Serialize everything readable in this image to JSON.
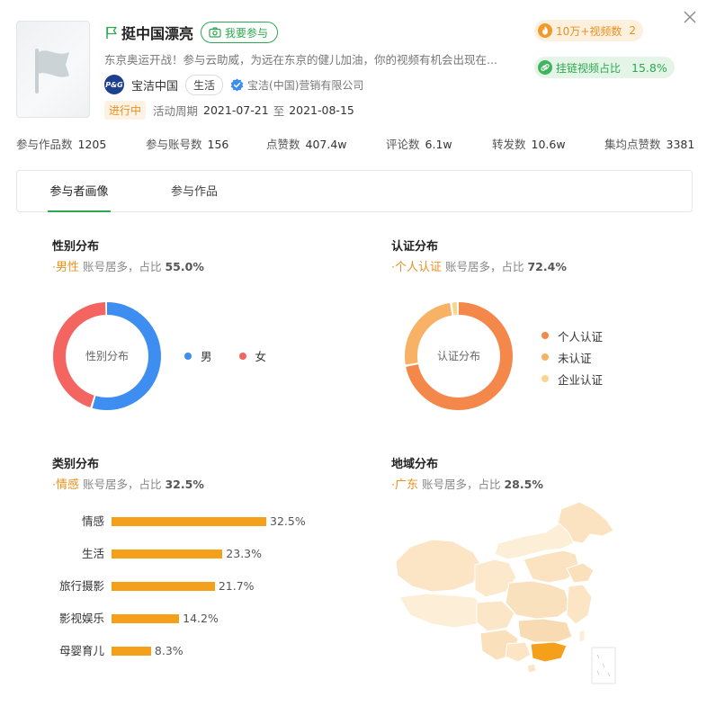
{
  "header": {
    "title": "挺中国漂亮",
    "join_label": "我要参与",
    "description": "东京奥运开战！参与云助威，为远在东京的健儿加油，你的视频有机会出现在...",
    "brand_logo_text": "P&G",
    "brand_name": "宝洁中国",
    "brand_tag": "生活",
    "company": "宝洁(中国)营销有限公司",
    "status": "进行中",
    "period_label": "活动周期",
    "start_date": "2021-07-21",
    "period_sep": "至",
    "end_date": "2021-08-15",
    "pill_orange_label": "10万+视频数",
    "pill_orange_value": "2",
    "pill_green_label": "挂链视频占比",
    "pill_green_value": "15.8%"
  },
  "stats": [
    {
      "label": "参与作品数",
      "value": "1205"
    },
    {
      "label": "参与账号数",
      "value": "156"
    },
    {
      "label": "点赞数",
      "value": "407.4w"
    },
    {
      "label": "评论数",
      "value": "6.1w"
    },
    {
      "label": "转发数",
      "value": "10.6w"
    },
    {
      "label": "集均点赞数",
      "value": "3381"
    }
  ],
  "tabs": [
    {
      "label": "参与者画像",
      "active": true
    },
    {
      "label": "参与作品",
      "active": false
    }
  ],
  "gender": {
    "title": "性别分布",
    "highlight": "男性",
    "sub_text": "账号居多，占比",
    "pct": "55.0%",
    "center_label": "性别分布",
    "legend": [
      {
        "label": "男",
        "color": "#3d8ef0",
        "share": 55.0
      },
      {
        "label": "女",
        "color": "#f46461",
        "share": 45.0
      }
    ]
  },
  "cert": {
    "title": "认证分布",
    "highlight": "个人认证",
    "sub_text": "账号居多，占比",
    "pct": "72.4%",
    "center_label": "认证分布",
    "legend": [
      {
        "label": "个人认证",
        "color": "#f3884a",
        "share": 72.4
      },
      {
        "label": "未认证",
        "color": "#f7b265",
        "share": 25.5
      },
      {
        "label": "企业认证",
        "color": "#f9d68f",
        "share": 2.1
      }
    ]
  },
  "category": {
    "title": "类别分布",
    "highlight": "情感",
    "sub_text": "账号居多，占比",
    "pct": "32.5%",
    "bars": [
      {
        "label": "情感",
        "value": 32.5,
        "value_text": "32.5%"
      },
      {
        "label": "生活",
        "value": 23.3,
        "value_text": "23.3%"
      },
      {
        "label": "旅行摄影",
        "value": 21.7,
        "value_text": "21.7%"
      },
      {
        "label": "影视娱乐",
        "value": 14.2,
        "value_text": "14.2%"
      },
      {
        "label": "母婴育儿",
        "value": 8.3,
        "value_text": "8.3%"
      }
    ]
  },
  "region": {
    "title": "地域分布",
    "highlight": "广东",
    "sub_text": "账号居多，占比",
    "pct": "28.5%",
    "highlight_color": "#f5a01a",
    "base_color": "#fbe9cd"
  }
}
